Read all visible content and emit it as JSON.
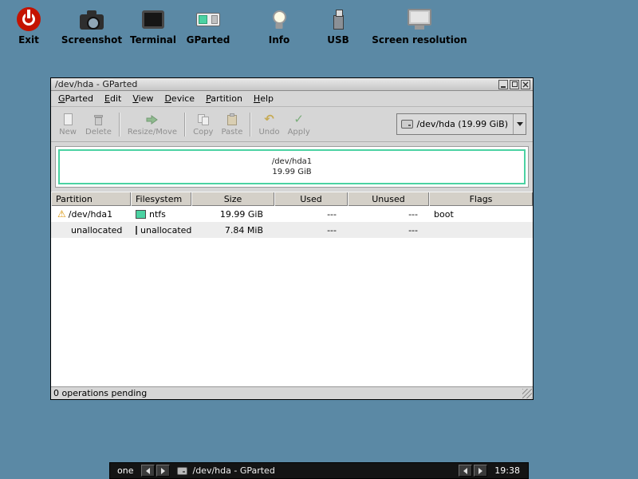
{
  "colors": {
    "desktop_bg": "#5b89a5",
    "ntfs": "#4bd2a2",
    "unallocated": "#a9a9a9"
  },
  "desktop": {
    "icons": [
      {
        "label": "Exit"
      },
      {
        "label": "Screenshot"
      },
      {
        "label": "Terminal"
      },
      {
        "label": "GParted"
      },
      {
        "label": "Info"
      },
      {
        "label": "USB"
      },
      {
        "label": "Screen resolution"
      }
    ]
  },
  "window": {
    "title": "/dev/hda - GParted",
    "menu": [
      "GParted",
      "Edit",
      "View",
      "Device",
      "Partition",
      "Help"
    ],
    "toolbar": {
      "new": "New",
      "delete": "Delete",
      "resize": "Resize/Move",
      "copy": "Copy",
      "paste": "Paste",
      "undo": "Undo",
      "apply": "Apply"
    },
    "device_selector": {
      "value": "/dev/hda (19.99 GiB)"
    },
    "visual": {
      "partition": "/dev/hda1",
      "size": "19.99 GiB"
    },
    "table": {
      "headers": [
        "Partition",
        "Filesystem",
        "Size",
        "Used",
        "Unused",
        "Flags"
      ],
      "rows": [
        {
          "partition": "/dev/hda1",
          "filesystem": "ntfs",
          "size": "19.99 GiB",
          "used": "---",
          "unused": "---",
          "flags": "boot"
        },
        {
          "partition": "unallocated",
          "filesystem": "unallocated",
          "size": "7.84 MiB",
          "used": "---",
          "unused": "---",
          "flags": ""
        }
      ]
    },
    "statusbar": "0 operations pending"
  },
  "taskbar": {
    "workspace": "one",
    "task": "/dev/hda - GParted",
    "clock": "19:38"
  }
}
